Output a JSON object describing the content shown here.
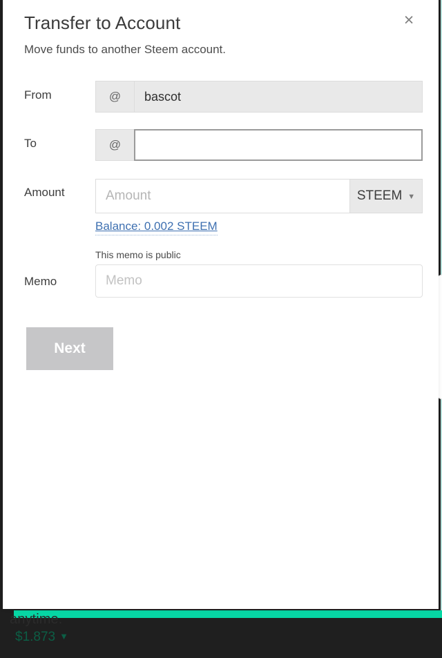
{
  "modal": {
    "title": "Transfer to Account",
    "subtitle": "Move funds to another Steem account.",
    "close_label": "×"
  },
  "form": {
    "from": {
      "label": "From",
      "prefix": "@",
      "value": "bascot",
      "placeholder": ""
    },
    "to": {
      "label": "To",
      "prefix": "@",
      "value": "",
      "placeholder": ""
    },
    "amount": {
      "label": "Amount",
      "value": "",
      "placeholder": "Amount",
      "asset": "STEEM",
      "caret": "▼",
      "balance_link": "Balance: 0.002 STEEM"
    },
    "memo": {
      "label": "Memo",
      "hint": "This memo is public",
      "value": "",
      "placeholder": "Memo"
    },
    "submit_label": "Next"
  },
  "background": {
    "text_fragment": "anytime.",
    "price": "$1.873",
    "price_caret": "▼"
  },
  "colors": {
    "accent_teal": "#06d6a4",
    "link_blue": "#3d6fb0",
    "disabled_button": "#c6c6c8",
    "dark_page": "#1f1f1f",
    "price_green": "#0c5e45"
  }
}
